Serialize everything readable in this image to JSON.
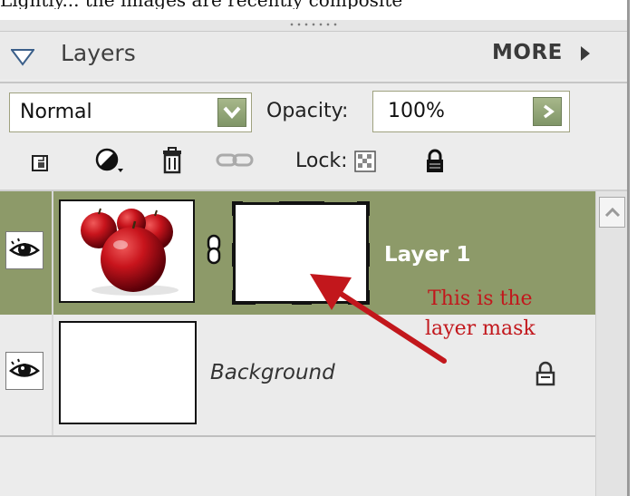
{
  "caption": "Lightly... the images are recently composite",
  "panel": {
    "title": "Layers",
    "more_label": "MORE"
  },
  "blend": {
    "mode": "Normal",
    "opacity_label": "Opacity:",
    "opacity_value": "100%"
  },
  "tools": {
    "lock_label": "Lock:",
    "icons": [
      "new-layer-icon",
      "adjustment-layer-icon",
      "trash-icon",
      "link-icon",
      "lock-transparency-icon",
      "lock-all-icon"
    ]
  },
  "layers": [
    {
      "name": "Layer 1",
      "selected": true,
      "has_mask": true
    },
    {
      "name": "Background",
      "selected": false,
      "locked": true
    }
  ],
  "annotation": {
    "line1": "This is the",
    "line2": "layer mask"
  },
  "colors": {
    "selected_row": "#8d9a69",
    "annotation": "#c2171c",
    "button_green": "#8fa375"
  }
}
